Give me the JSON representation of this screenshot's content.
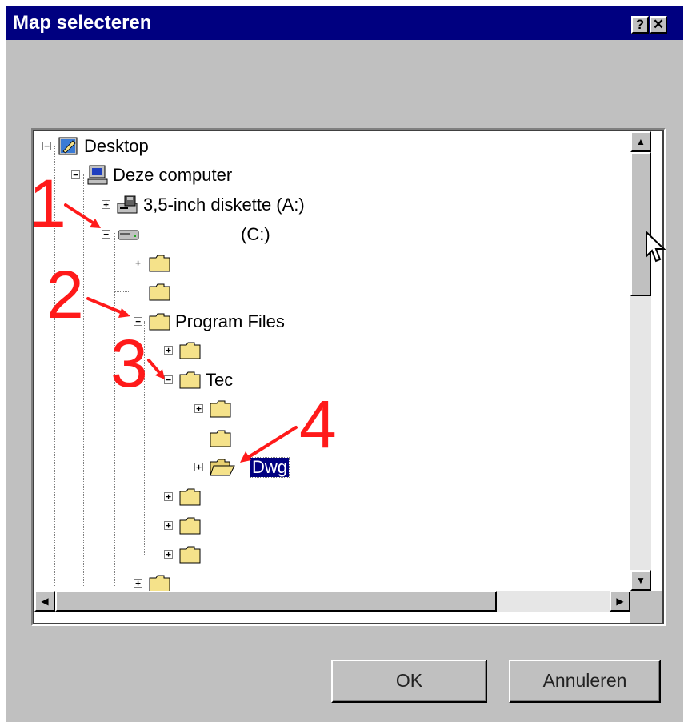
{
  "window": {
    "title": "Map selecteren",
    "help_label": "?",
    "close_label": "✕"
  },
  "tree": {
    "nodes": [
      {
        "label": "Desktop",
        "icon": "desktop-icon",
        "expander": "minus"
      },
      {
        "label": "Deze computer",
        "icon": "computer-icon",
        "expander": "minus"
      },
      {
        "label": "3,5-inch diskette (A:)",
        "icon": "floppy-drive-icon",
        "expander": "plus"
      },
      {
        "label": "(C:)",
        "icon": "hard-drive-icon",
        "expander": "minus"
      },
      {
        "label": "",
        "icon": "folder-icon",
        "expander": "plus"
      },
      {
        "label": "",
        "icon": "folder-icon",
        "expander": "none"
      },
      {
        "label": "Program Files",
        "icon": "folder-icon",
        "expander": "minus"
      },
      {
        "label": "",
        "icon": "folder-icon",
        "expander": "plus"
      },
      {
        "label": "Tec",
        "icon": "folder-icon",
        "expander": "minus"
      },
      {
        "label": "",
        "icon": "folder-icon",
        "expander": "plus"
      },
      {
        "label": "",
        "icon": "folder-icon",
        "expander": "none"
      },
      {
        "label": "Dwg",
        "icon": "open-folder-icon",
        "expander": "plus",
        "selected": true
      },
      {
        "label": "",
        "icon": "folder-icon",
        "expander": "plus"
      },
      {
        "label": "",
        "icon": "folder-icon",
        "expander": "plus"
      },
      {
        "label": "",
        "icon": "folder-icon",
        "expander": "plus"
      },
      {
        "label": "",
        "icon": "folder-icon",
        "expander": "plus"
      }
    ]
  },
  "buttons": {
    "ok": "OK",
    "cancel": "Annuleren"
  },
  "annotations": [
    "1",
    "2",
    "3",
    "4"
  ],
  "colors": {
    "titlebar": "#000080",
    "face": "#c0c0c0",
    "selection": "#000080",
    "annotation": "#ff1a1a",
    "folder": "#f5e28a"
  }
}
